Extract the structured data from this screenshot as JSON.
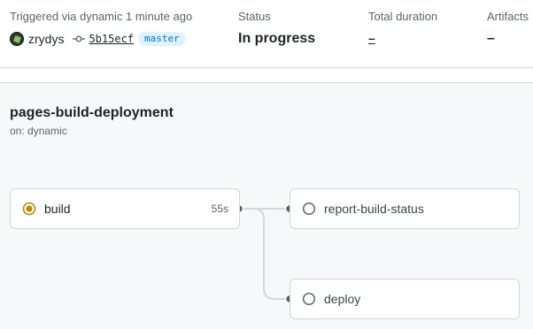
{
  "summary": {
    "trigger_label": "Triggered via dynamic 1 minute ago",
    "actor": {
      "name": "zrydys",
      "avatar_icon": "user-avatar"
    },
    "commit": {
      "sha": "5b15ecf",
      "icon": "git-commit-icon"
    },
    "branch": "master",
    "status": {
      "label": "Status",
      "value": "In progress"
    },
    "duration": {
      "label": "Total duration",
      "value": "–"
    },
    "artifacts": {
      "label": "Artifacts",
      "value": "–"
    }
  },
  "workflow": {
    "name": "pages-build-deployment",
    "trigger": "on: dynamic",
    "jobs": [
      {
        "name": "build",
        "status": "in_progress",
        "icon": "in-progress-icon",
        "duration": "55s"
      },
      {
        "name": "report-build-status",
        "status": "queued",
        "icon": "pending-circle-icon",
        "duration": ""
      },
      {
        "name": "deploy",
        "status": "queued",
        "icon": "pending-circle-icon",
        "duration": ""
      }
    ],
    "edges": [
      {
        "from": "build",
        "to": "report-build-status"
      },
      {
        "from": "build",
        "to": "deploy"
      }
    ]
  },
  "colors": {
    "in_progress": "#bf8700",
    "queued_outline": "#59636e",
    "connector": "#d0d7de",
    "node_dot": "#57606a",
    "link": "#0969da",
    "badge_bg": "#ddf4ff"
  }
}
